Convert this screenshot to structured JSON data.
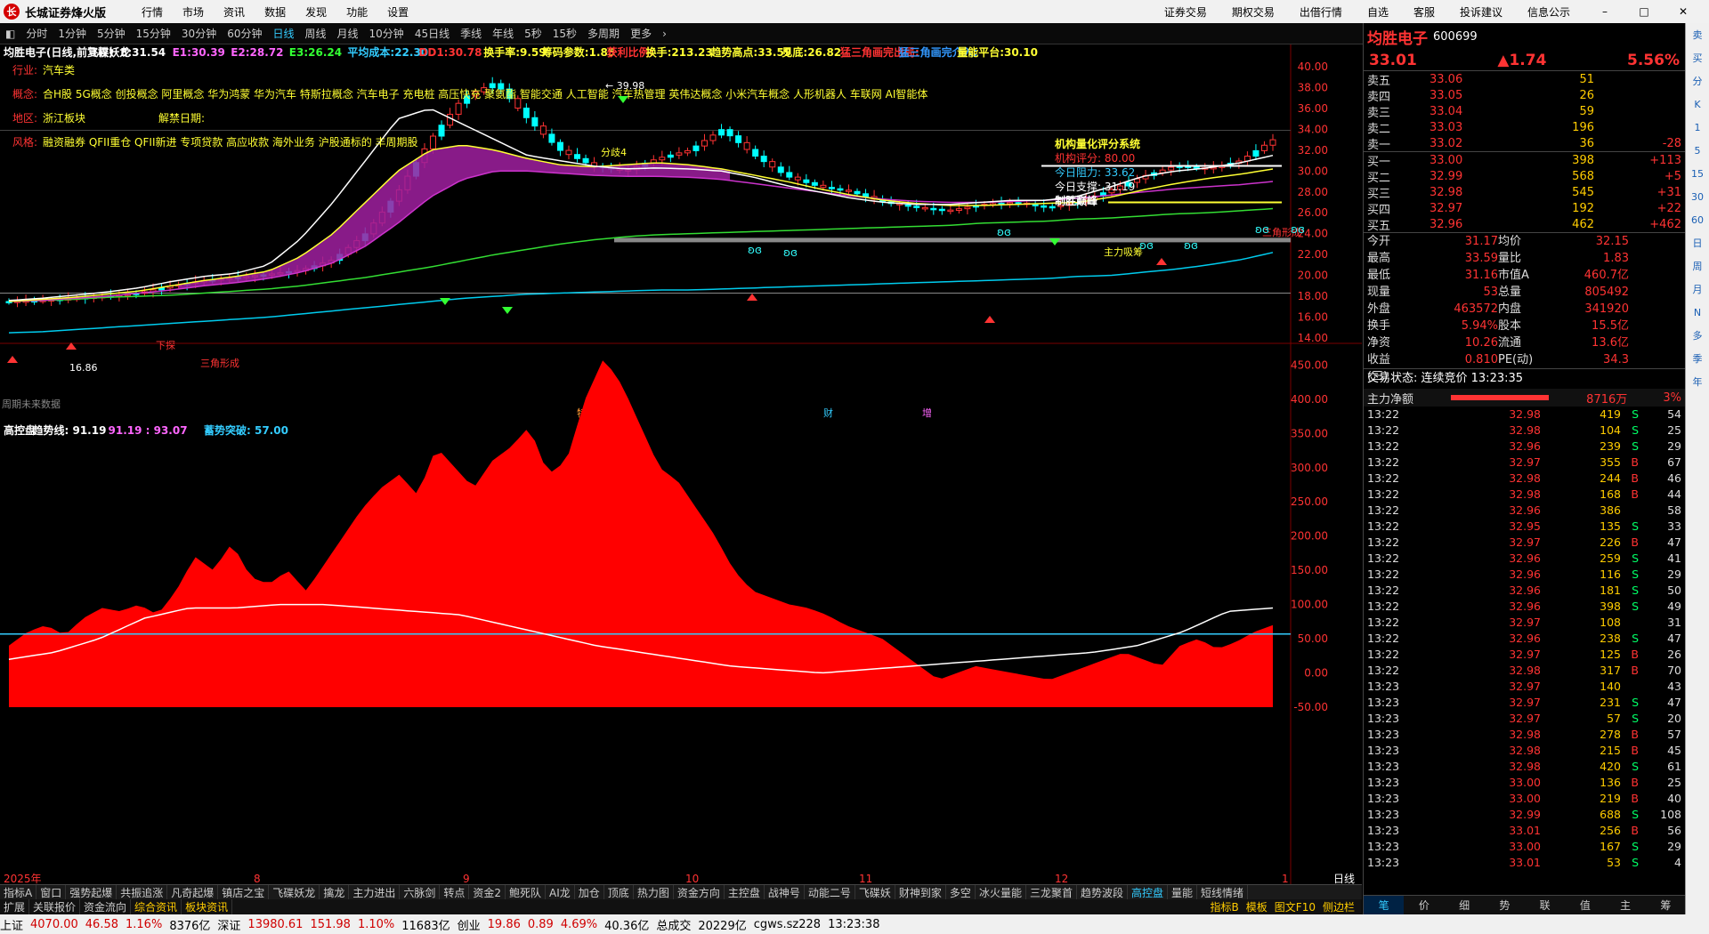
{
  "app": {
    "title": "长城证券烽火版",
    "menu": [
      "行情",
      "市场",
      "资讯",
      "数据",
      "发现",
      "功能",
      "设置"
    ],
    "right_menu": [
      "证券交易",
      "期权交易",
      "出借行情",
      "自选",
      "客服",
      "投诉建议",
      "信息公示"
    ]
  },
  "periods": [
    "分时",
    "1分钟",
    "5分钟",
    "15分钟",
    "30分钟",
    "60分钟",
    "日线",
    "周线",
    "月线",
    "10分钟",
    "45日线",
    "季线",
    "年线",
    "5秒",
    "15秒",
    "多周期",
    "更多"
  ],
  "active_period": "日线",
  "toolbar_right": [
    "复权",
    "叠加",
    "多股",
    "统计",
    "画线",
    "F10",
    "+自选",
    "返回"
  ],
  "main_legend": [
    "均胜电子(日线,前复权)",
    "飞碟妖龙",
    "E:31.54",
    "E1:30.39",
    "E2:28.72",
    "E3:26.24",
    "平均成本:22.30",
    "DD1:30.78",
    "换手率:9.59",
    "筹码参数:1.85",
    "获利比例:",
    "换手:213.23",
    "趋势高点:33.59",
    "见底:26.82",
    "猛三角画完出局:",
    "猛三角画完介入:",
    "量能平台:30.10"
  ],
  "info_lines": [
    [
      "行业:",
      "汽车类"
    ],
    [
      "概念:",
      "合H股 5G概念 创投概念 阿里概念 华为鸿蒙 华为汽车 特斯拉概念 汽车电子 充电桩 高压快充 聚氨酯 智能交通 人工智能 汽车热管理 英伟达概念 小米汽车概念 人形机器人 车联网 AI智能体"
    ],
    [
      "地区:",
      "浙江板块"
    ],
    [
      "风格:",
      "融资融券 QFII重仓 QFII新进 专项贷款 高应收款 海外业务 沪股通标的 丰周期股"
    ]
  ],
  "jiejin": "解禁日期:",
  "eval": {
    "title": "机构量化评分系统",
    "rows": [
      "机构评分: 80.00",
      "今日阻力: 33.62",
      "今日支撑: 31.19"
    ],
    "note": "制胜巅峰"
  },
  "labels": {
    "max": "39.98",
    "min": "16.86",
    "fenqi": "分歧4",
    "zhuli": "主力吸筹",
    "sanjiao": "三角形成",
    "sanjiao2": "三角形成",
    "xiatan": "下探",
    "future": "周期未来数据",
    "ev1": "特跌",
    "ev2": "财",
    "ev3": "增"
  },
  "y_ticks": [
    "40.00",
    "38.00",
    "36.00",
    "34.00",
    "32.00",
    "30.00",
    "28.00",
    "26.00",
    "24.00",
    "22.00",
    "20.00",
    "18.00",
    "16.00",
    "14.00"
  ],
  "sub_legend": [
    "高控盘",
    "趋势线: 91.19",
    "91.19 : 93.07",
    "蓄势突破: 57.00"
  ],
  "sub_y_ticks": [
    "450.00",
    "400.00",
    "350.00",
    "300.00",
    "250.00",
    "200.00",
    "150.00",
    "100.00",
    "50.00",
    "0.00",
    "-50.00"
  ],
  "x_labels": [
    "2025年",
    "8",
    "9",
    "10",
    "11",
    "12",
    "1"
  ],
  "quote": {
    "name": "均胜电子",
    "code": "600699",
    "price": "33.01",
    "change": "▲1.74",
    "pct": "5.56%"
  },
  "asks": [
    {
      "l": "卖五",
      "p": "33.06",
      "v": "51",
      "d": ""
    },
    {
      "l": "卖四",
      "p": "33.05",
      "v": "26",
      "d": ""
    },
    {
      "l": "卖三",
      "p": "33.04",
      "v": "59",
      "d": ""
    },
    {
      "l": "卖二",
      "p": "33.03",
      "v": "196",
      "d": ""
    },
    {
      "l": "卖一",
      "p": "33.02",
      "v": "36",
      "d": "-28"
    }
  ],
  "bids": [
    {
      "l": "买一",
      "p": "33.00",
      "v": "398",
      "d": "+113"
    },
    {
      "l": "买二",
      "p": "32.99",
      "v": "568",
      "d": "+5"
    },
    {
      "l": "买三",
      "p": "32.98",
      "v": "545",
      "d": "+31"
    },
    {
      "l": "买四",
      "p": "32.97",
      "v": "192",
      "d": "+22"
    },
    {
      "l": "买五",
      "p": "32.96",
      "v": "462",
      "d": "+462"
    }
  ],
  "stats": [
    [
      "今开",
      "31.17",
      "均价",
      "32.15"
    ],
    [
      "最高",
      "33.59",
      "量比",
      "1.83"
    ],
    [
      "最低",
      "31.16",
      "市值A",
      "460.7亿"
    ],
    [
      "现量",
      "53",
      "总量",
      "805492"
    ],
    [
      "外盘",
      "463572",
      "内盘",
      "341920"
    ],
    [
      "换手",
      "5.94%",
      "股本",
      "15.5亿"
    ],
    [
      "净资",
      "10.26",
      "流通",
      "13.6亿"
    ],
    [
      "收益(三)",
      "0.810",
      "PE(动)",
      "34.3"
    ]
  ],
  "trade_status": "交易状态: 连续竞价 13:23:35",
  "flow": {
    "label": "主力净额",
    "value": "8716万",
    "pct": "3%"
  },
  "ticks": [
    [
      "13:22",
      "32.98",
      "419",
      "S",
      "54"
    ],
    [
      "13:22",
      "32.98",
      "104",
      "S",
      "25"
    ],
    [
      "13:22",
      "32.96",
      "239",
      "S",
      "29"
    ],
    [
      "13:22",
      "32.97",
      "355",
      "B",
      "67"
    ],
    [
      "13:22",
      "32.98",
      "244",
      "B",
      "46"
    ],
    [
      "13:22",
      "32.98",
      "168",
      "B",
      "44"
    ],
    [
      "13:22",
      "32.96",
      "386",
      "",
      "58"
    ],
    [
      "13:22",
      "32.95",
      "135",
      "S",
      "33"
    ],
    [
      "13:22",
      "32.97",
      "226",
      "B",
      "47"
    ],
    [
      "13:22",
      "32.96",
      "259",
      "S",
      "41"
    ],
    [
      "13:22",
      "32.96",
      "116",
      "S",
      "29"
    ],
    [
      "13:22",
      "32.96",
      "181",
      "S",
      "50"
    ],
    [
      "13:22",
      "32.96",
      "398",
      "S",
      "49"
    ],
    [
      "13:22",
      "32.97",
      "108",
      "",
      "31"
    ],
    [
      "13:22",
      "32.96",
      "238",
      "S",
      "47"
    ],
    [
      "13:22",
      "32.97",
      "125",
      "B",
      "26"
    ],
    [
      "13:22",
      "32.98",
      "317",
      "B",
      "70"
    ],
    [
      "13:23",
      "32.97",
      "140",
      "",
      "43"
    ],
    [
      "13:23",
      "32.97",
      "231",
      "S",
      "47"
    ],
    [
      "13:23",
      "32.97",
      "57",
      "S",
      "20"
    ],
    [
      "13:23",
      "32.98",
      "278",
      "B",
      "57"
    ],
    [
      "13:23",
      "32.98",
      "215",
      "B",
      "45"
    ],
    [
      "13:23",
      "32.98",
      "420",
      "S",
      "61"
    ],
    [
      "13:23",
      "33.00",
      "136",
      "B",
      "25"
    ],
    [
      "13:23",
      "33.00",
      "219",
      "B",
      "40"
    ],
    [
      "13:23",
      "32.99",
      "688",
      "S",
      "108"
    ],
    [
      "13:23",
      "33.01",
      "256",
      "B",
      "56"
    ],
    [
      "13:23",
      "33.00",
      "167",
      "S",
      "29"
    ],
    [
      "13:23",
      "33.01",
      "53",
      "S",
      "4"
    ]
  ],
  "rp_tabs": [
    "笔",
    "价",
    "细",
    "势",
    "联",
    "值",
    "主",
    "筹"
  ],
  "bottom_tabs": [
    "指标A",
    "窗口",
    "强势起爆",
    "共振追涨",
    "凡奇起爆",
    "镇店之宝",
    "飞碟妖龙",
    "擒龙",
    "主力进出",
    "六脉剑",
    "转点",
    "资金2",
    "鲍死队",
    "AI龙",
    "加仓",
    "顶底",
    "热力图",
    "资金方向",
    "主控盘",
    "战神号",
    "动能二号",
    "飞碟妖",
    "财神到家",
    "多空",
    "冰火量能",
    "三龙聚首",
    "趋势波段",
    "高控盘",
    "量能",
    "短线情绪"
  ],
  "bottom_tabs_active": "高控盘",
  "bottom_tabs2": [
    "扩展",
    "关联报价",
    "资金流向",
    "综合资讯",
    "板块资讯"
  ],
  "bottom_right": [
    "指标B",
    "模板",
    "图文F10",
    "侧边栏"
  ],
  "period_label": "日线",
  "vstrip": [
    "卖",
    "买",
    "分",
    "K",
    "1",
    "5",
    "15",
    "30",
    "60",
    "日",
    "周",
    "月",
    "N",
    "多",
    "季",
    "年"
  ],
  "statusbar": [
    {
      "t": "上证",
      "c": "k"
    },
    {
      "t": "4070.00",
      "c": "r"
    },
    {
      "t": "46.58",
      "c": "r"
    },
    {
      "t": "1.16%",
      "c": "r"
    },
    {
      "t": "8376亿",
      "c": "k"
    },
    {
      "t": "深证",
      "c": "k"
    },
    {
      "t": "13980.61",
      "c": "r"
    },
    {
      "t": "151.98",
      "c": "r"
    },
    {
      "t": "1.10%",
      "c": "r"
    },
    {
      "t": "11683亿",
      "c": "k"
    },
    {
      "t": "创业",
      "c": "k"
    },
    {
      "t": "19.86",
      "c": "r"
    },
    {
      "t": "0.89",
      "c": "r"
    },
    {
      "t": "4.69%",
      "c": "r"
    },
    {
      "t": "40.36亿",
      "c": "k"
    },
    {
      "t": "总成交",
      "c": "k"
    },
    {
      "t": "20229亿",
      "c": "k"
    },
    {
      "t": "cgws.sz228",
      "c": "k"
    },
    {
      "t": "13:23:38",
      "c": "k"
    }
  ],
  "colors": {
    "up": "#ff3333",
    "down": "#00ffff",
    "bg": "#000000",
    "accent": "#33ccff",
    "yellow": "#ffff00"
  },
  "chart_data": {
    "type": "line",
    "note_series": [
      "close",
      "ma_white",
      "ma_yellow",
      "ma_magenta",
      "ma_green",
      "ma_cyan",
      "sub_area"
    ],
    "y_range": [
      14,
      40
    ],
    "sub_range": [
      -50,
      470
    ]
  }
}
